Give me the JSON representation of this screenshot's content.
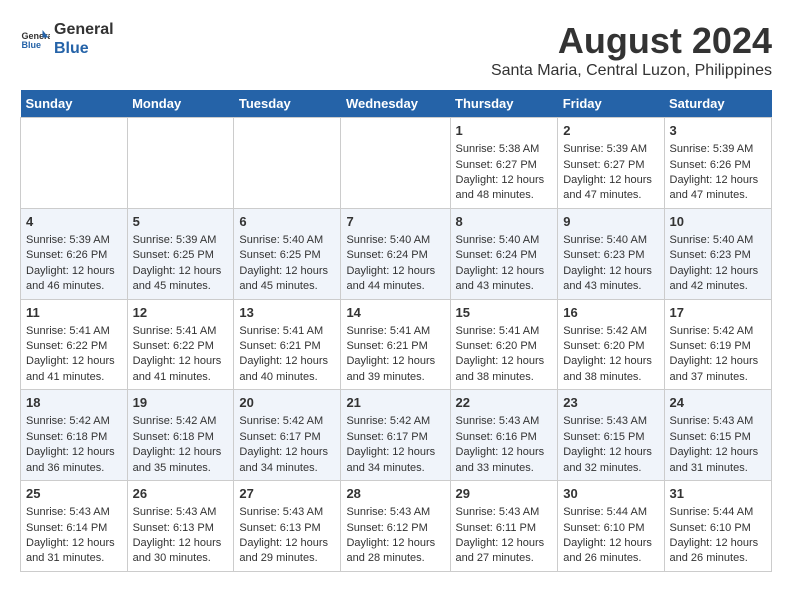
{
  "logo": {
    "line1": "General",
    "line2": "Blue"
  },
  "title": "August 2024",
  "subtitle": "Santa Maria, Central Luzon, Philippines",
  "days_of_week": [
    "Sunday",
    "Monday",
    "Tuesday",
    "Wednesday",
    "Thursday",
    "Friday",
    "Saturday"
  ],
  "weeks": [
    [
      {
        "day": "",
        "content": ""
      },
      {
        "day": "",
        "content": ""
      },
      {
        "day": "",
        "content": ""
      },
      {
        "day": "",
        "content": ""
      },
      {
        "day": "1",
        "content": "Sunrise: 5:38 AM\nSunset: 6:27 PM\nDaylight: 12 hours\nand 48 minutes."
      },
      {
        "day": "2",
        "content": "Sunrise: 5:39 AM\nSunset: 6:27 PM\nDaylight: 12 hours\nand 47 minutes."
      },
      {
        "day": "3",
        "content": "Sunrise: 5:39 AM\nSunset: 6:26 PM\nDaylight: 12 hours\nand 47 minutes."
      }
    ],
    [
      {
        "day": "4",
        "content": "Sunrise: 5:39 AM\nSunset: 6:26 PM\nDaylight: 12 hours\nand 46 minutes."
      },
      {
        "day": "5",
        "content": "Sunrise: 5:39 AM\nSunset: 6:25 PM\nDaylight: 12 hours\nand 45 minutes."
      },
      {
        "day": "6",
        "content": "Sunrise: 5:40 AM\nSunset: 6:25 PM\nDaylight: 12 hours\nand 45 minutes."
      },
      {
        "day": "7",
        "content": "Sunrise: 5:40 AM\nSunset: 6:24 PM\nDaylight: 12 hours\nand 44 minutes."
      },
      {
        "day": "8",
        "content": "Sunrise: 5:40 AM\nSunset: 6:24 PM\nDaylight: 12 hours\nand 43 minutes."
      },
      {
        "day": "9",
        "content": "Sunrise: 5:40 AM\nSunset: 6:23 PM\nDaylight: 12 hours\nand 43 minutes."
      },
      {
        "day": "10",
        "content": "Sunrise: 5:40 AM\nSunset: 6:23 PM\nDaylight: 12 hours\nand 42 minutes."
      }
    ],
    [
      {
        "day": "11",
        "content": "Sunrise: 5:41 AM\nSunset: 6:22 PM\nDaylight: 12 hours\nand 41 minutes."
      },
      {
        "day": "12",
        "content": "Sunrise: 5:41 AM\nSunset: 6:22 PM\nDaylight: 12 hours\nand 41 minutes."
      },
      {
        "day": "13",
        "content": "Sunrise: 5:41 AM\nSunset: 6:21 PM\nDaylight: 12 hours\nand 40 minutes."
      },
      {
        "day": "14",
        "content": "Sunrise: 5:41 AM\nSunset: 6:21 PM\nDaylight: 12 hours\nand 39 minutes."
      },
      {
        "day": "15",
        "content": "Sunrise: 5:41 AM\nSunset: 6:20 PM\nDaylight: 12 hours\nand 38 minutes."
      },
      {
        "day": "16",
        "content": "Sunrise: 5:42 AM\nSunset: 6:20 PM\nDaylight: 12 hours\nand 38 minutes."
      },
      {
        "day": "17",
        "content": "Sunrise: 5:42 AM\nSunset: 6:19 PM\nDaylight: 12 hours\nand 37 minutes."
      }
    ],
    [
      {
        "day": "18",
        "content": "Sunrise: 5:42 AM\nSunset: 6:18 PM\nDaylight: 12 hours\nand 36 minutes."
      },
      {
        "day": "19",
        "content": "Sunrise: 5:42 AM\nSunset: 6:18 PM\nDaylight: 12 hours\nand 35 minutes."
      },
      {
        "day": "20",
        "content": "Sunrise: 5:42 AM\nSunset: 6:17 PM\nDaylight: 12 hours\nand 34 minutes."
      },
      {
        "day": "21",
        "content": "Sunrise: 5:42 AM\nSunset: 6:17 PM\nDaylight: 12 hours\nand 34 minutes."
      },
      {
        "day": "22",
        "content": "Sunrise: 5:43 AM\nSunset: 6:16 PM\nDaylight: 12 hours\nand 33 minutes."
      },
      {
        "day": "23",
        "content": "Sunrise: 5:43 AM\nSunset: 6:15 PM\nDaylight: 12 hours\nand 32 minutes."
      },
      {
        "day": "24",
        "content": "Sunrise: 5:43 AM\nSunset: 6:15 PM\nDaylight: 12 hours\nand 31 minutes."
      }
    ],
    [
      {
        "day": "25",
        "content": "Sunrise: 5:43 AM\nSunset: 6:14 PM\nDaylight: 12 hours\nand 31 minutes."
      },
      {
        "day": "26",
        "content": "Sunrise: 5:43 AM\nSunset: 6:13 PM\nDaylight: 12 hours\nand 30 minutes."
      },
      {
        "day": "27",
        "content": "Sunrise: 5:43 AM\nSunset: 6:13 PM\nDaylight: 12 hours\nand 29 minutes."
      },
      {
        "day": "28",
        "content": "Sunrise: 5:43 AM\nSunset: 6:12 PM\nDaylight: 12 hours\nand 28 minutes."
      },
      {
        "day": "29",
        "content": "Sunrise: 5:43 AM\nSunset: 6:11 PM\nDaylight: 12 hours\nand 27 minutes."
      },
      {
        "day": "30",
        "content": "Sunrise: 5:44 AM\nSunset: 6:10 PM\nDaylight: 12 hours\nand 26 minutes."
      },
      {
        "day": "31",
        "content": "Sunrise: 5:44 AM\nSunset: 6:10 PM\nDaylight: 12 hours\nand 26 minutes."
      }
    ]
  ]
}
